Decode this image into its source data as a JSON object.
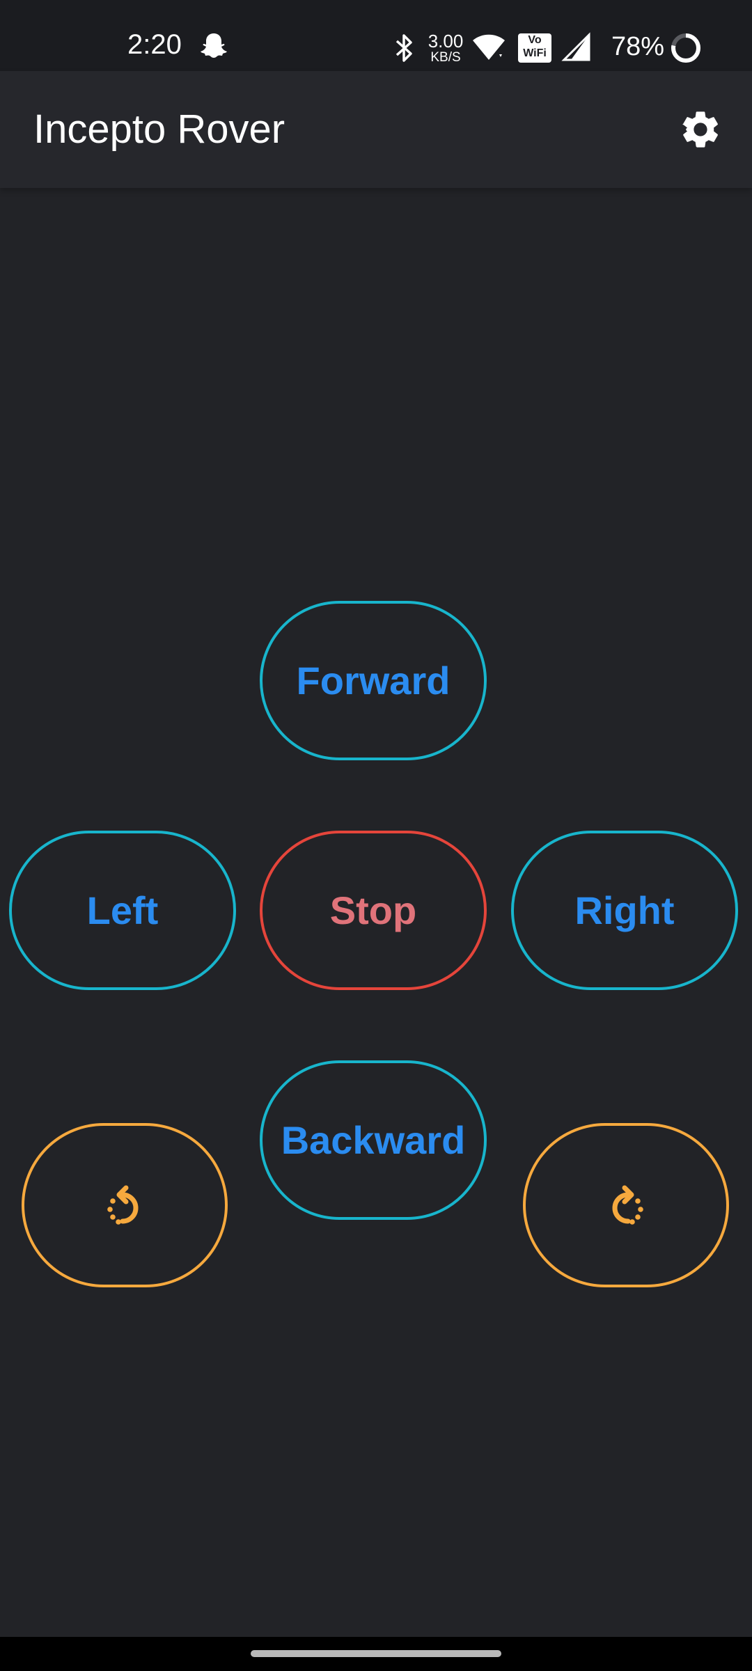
{
  "status_bar": {
    "time": "2:20",
    "net_speed_value": "3.00",
    "net_speed_unit": "KB/S",
    "vowifi_line1": "Vo",
    "vowifi_line2": "WiFi",
    "battery": "78%",
    "icons": [
      "snapchat-icon",
      "bluetooth-icon",
      "wifi-icon",
      "vowifi-icon",
      "signal-icon",
      "battery-ring-icon"
    ]
  },
  "app_bar": {
    "title": "Incepto Rover",
    "settings_icon": "gear-icon"
  },
  "controls": {
    "forward": "Forward",
    "left": "Left",
    "stop": "Stop",
    "right": "Right",
    "backward": "Backward",
    "rotate_left_icon": "rotate-left-icon",
    "rotate_right_icon": "rotate-right-icon"
  },
  "colors": {
    "background": "#222327",
    "app_bar": "#26272c",
    "move_border": "#18b5cc",
    "move_text": "#2b8cf0",
    "stop_border": "#e5453b",
    "stop_text": "#e0737a",
    "rotate_accent": "#f6a93e"
  }
}
